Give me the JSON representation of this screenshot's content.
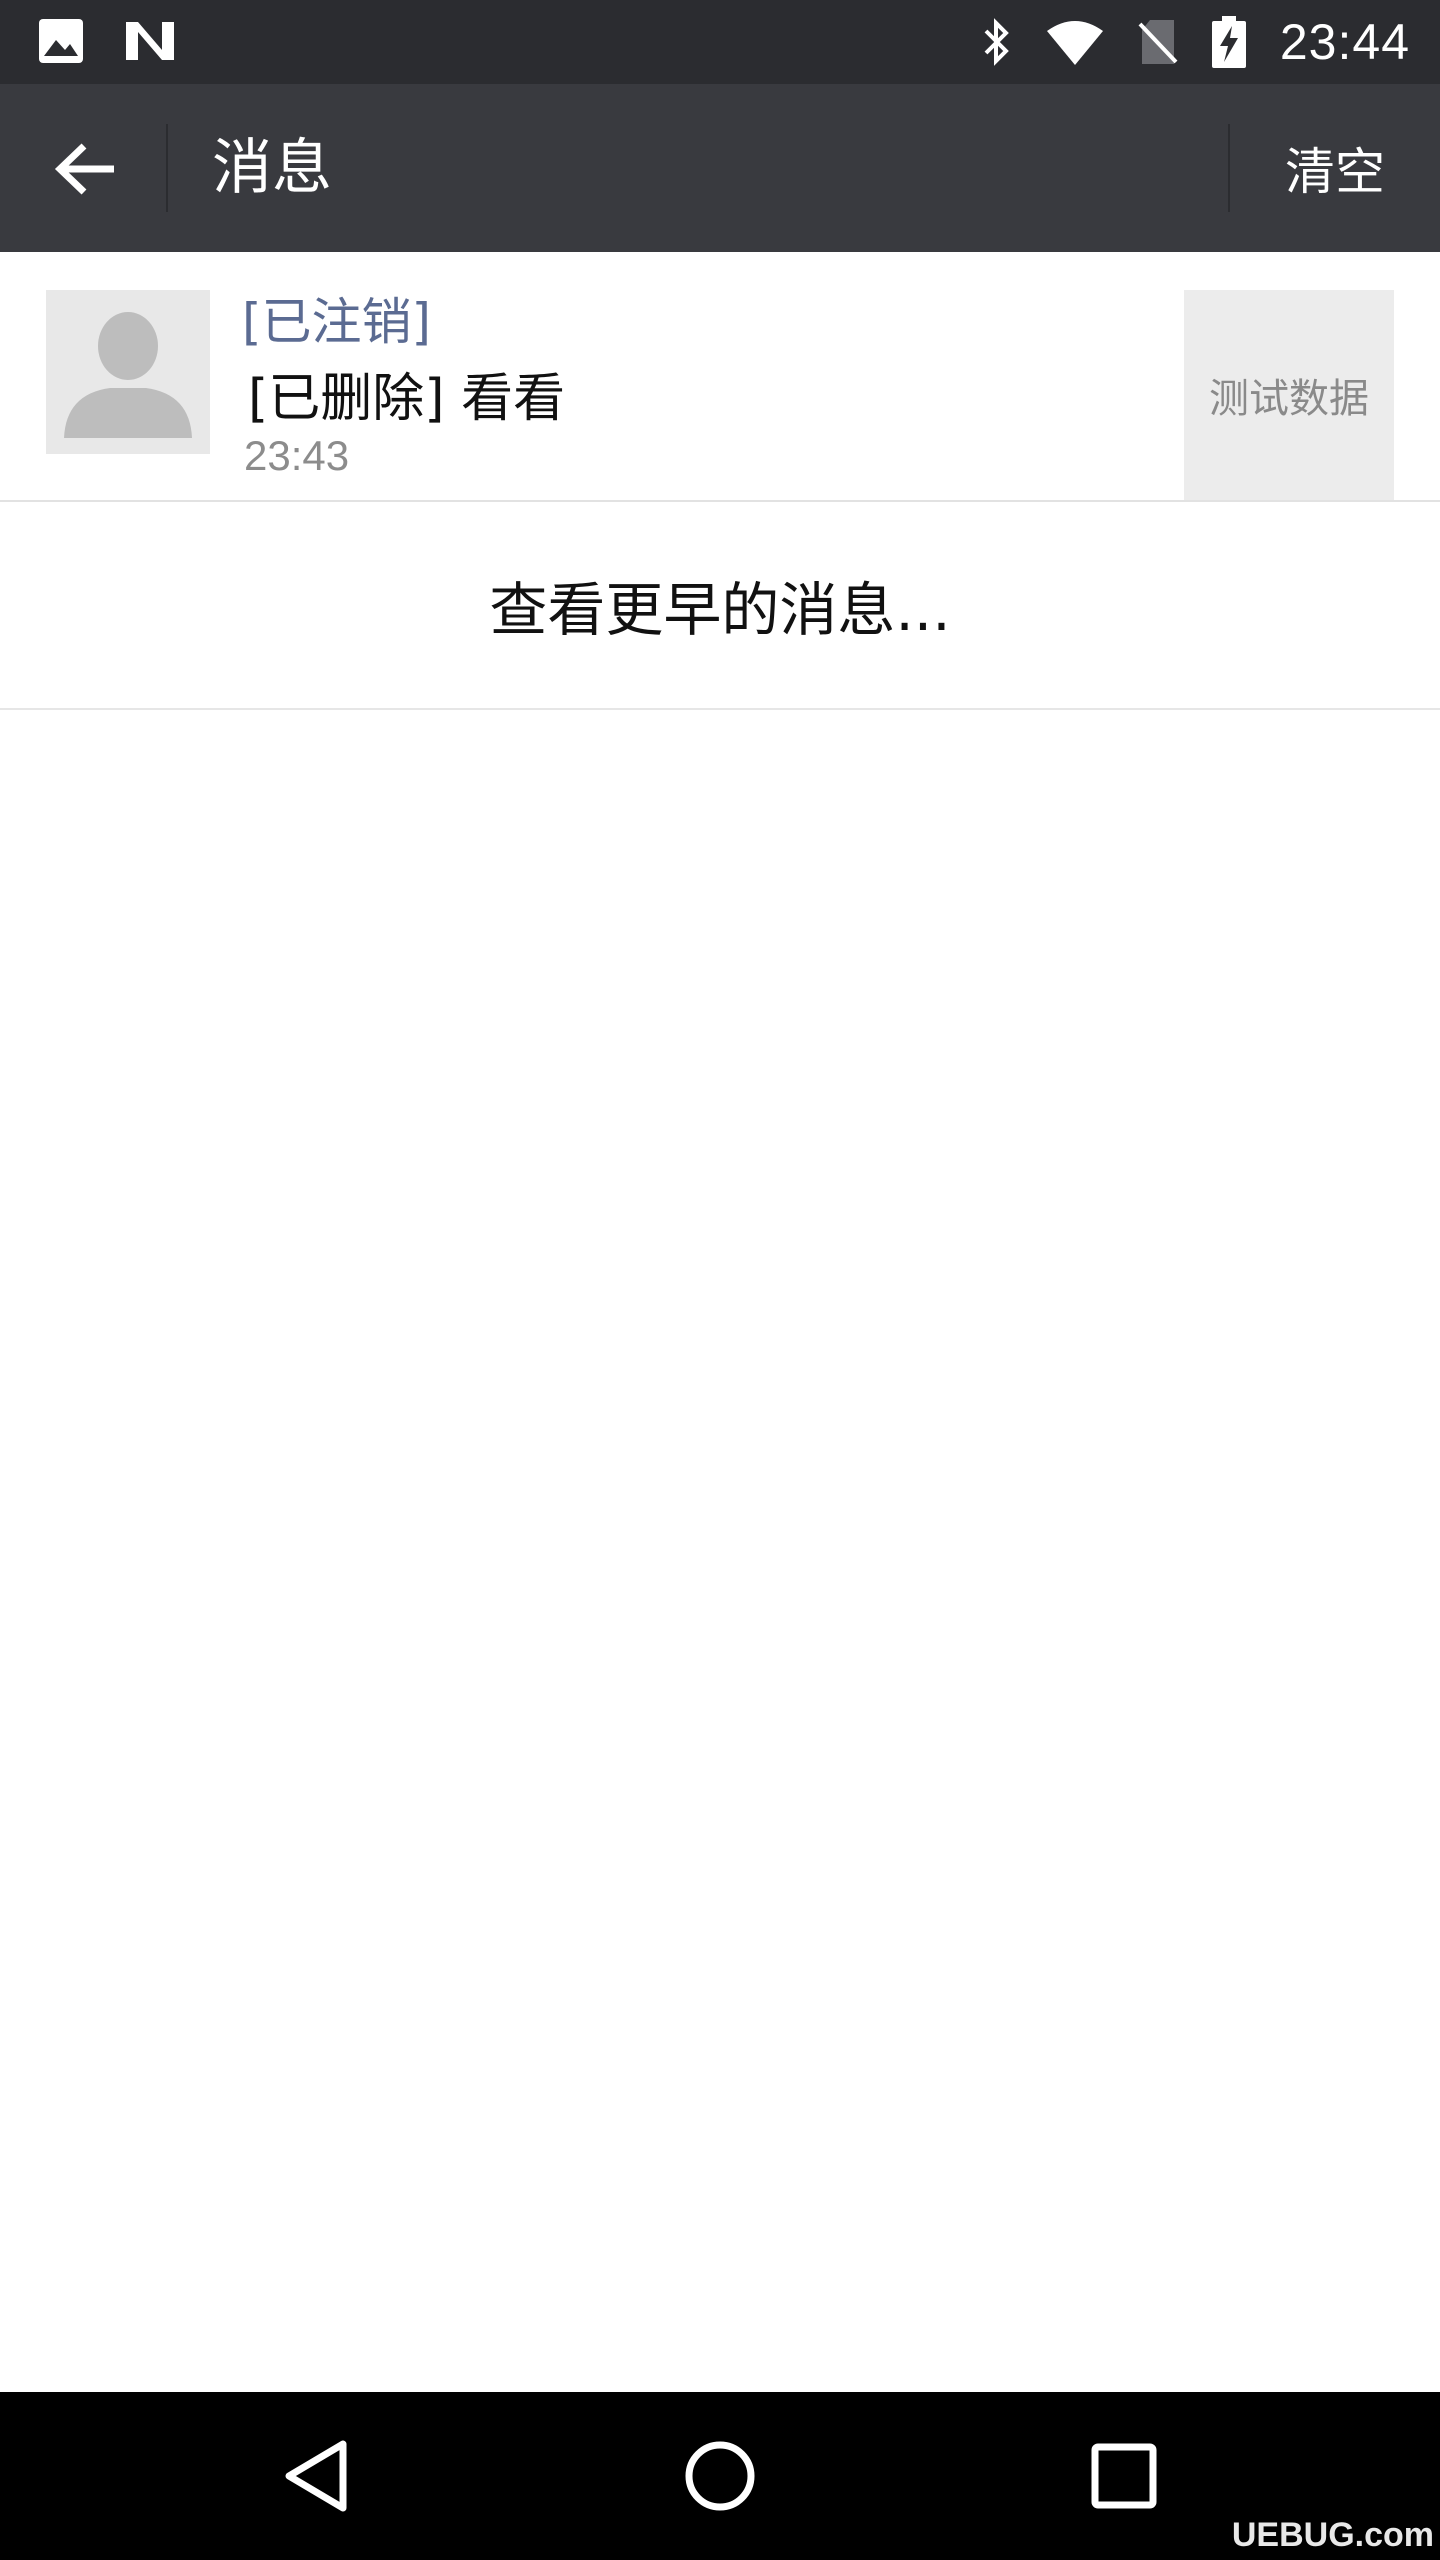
{
  "status_bar": {
    "time": "23:44",
    "left_icons": [
      "image-icon",
      "n-icon"
    ],
    "right_icons": [
      "bluetooth-icon",
      "wifi-icon",
      "no-sim-icon",
      "battery-charging-icon"
    ]
  },
  "header": {
    "title": "消息",
    "clear_label": "清空"
  },
  "messages": [
    {
      "name": "[已注销]",
      "content": "[已删除] 看看",
      "time": "23:43",
      "thumbnail_text": "测试数据"
    }
  ],
  "load_earlier_label": "查看更早的消息...",
  "nav": {
    "icons": [
      "back-triangle-icon",
      "home-circle-icon",
      "recents-square-icon"
    ]
  },
  "watermark": "UEBUG.com",
  "colors": {
    "status_bar_bg": "#2b2c30",
    "title_bar_bg": "#393a3f",
    "name_color": "#5b6b92",
    "nav_bar_bg": "#000000"
  }
}
